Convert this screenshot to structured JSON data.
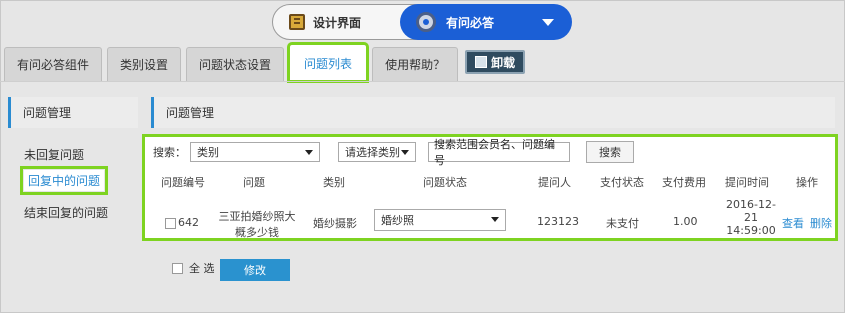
{
  "topbar": {
    "design_label": "设计界面",
    "app_label": "有问必答",
    "app_color": "#1b5fd6"
  },
  "tabs": [
    {
      "label": "有问必答组件"
    },
    {
      "label": "类别设置"
    },
    {
      "label": "问题状态设置"
    },
    {
      "label": "问题列表",
      "active": true
    },
    {
      "label": "使用帮助？"
    }
  ],
  "uninstall_label": "卸载",
  "sidebar": {
    "title": "问题管理",
    "items": [
      {
        "label": "未回复问题"
      },
      {
        "label": "回复中的问题",
        "active": true
      },
      {
        "label": "结束回复的问题"
      }
    ]
  },
  "main": {
    "title": "问题管理",
    "search": {
      "label": "搜索：",
      "type_select": "类别",
      "category_select": "请选择类别",
      "input_value": "搜索范围会员名、问题编号",
      "button": "搜索"
    },
    "columns": [
      "问题编号",
      "问题",
      "类别",
      "问题状态",
      "提问人",
      "支付状态",
      "支付费用",
      "提问时间",
      "操作"
    ],
    "rows": [
      {
        "id": "642",
        "question_line1": "三亚拍婚纱照大",
        "question_line2": "概多少钱",
        "category": "婚纱摄影",
        "status": "婚纱照",
        "asker": "123123",
        "pay_status": "未支付",
        "fee": "1.00",
        "time_line1": "2016-12-",
        "time_line2": "21",
        "time_line3": "14:59:00",
        "view": "查看",
        "delete": "删除"
      }
    ],
    "select_all": "全 选",
    "edit_button": "修改"
  },
  "colors": {
    "accent": "#2a8bd1",
    "highlight": "#7ed321"
  }
}
